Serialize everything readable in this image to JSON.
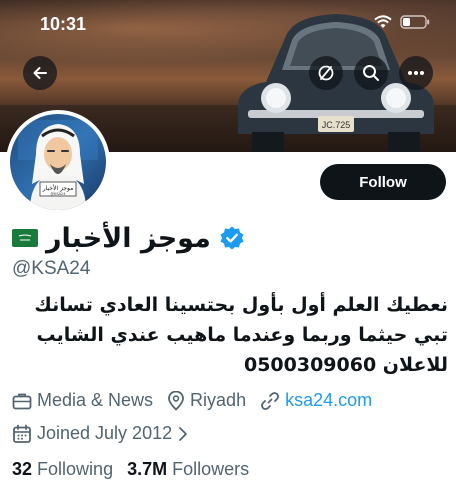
{
  "status_bar": {
    "time": "10:31"
  },
  "banner": {
    "plate_text": "JC.725"
  },
  "avatar": {
    "caption": "موجز الأخبار",
    "sub_caption": "@KSA24"
  },
  "profile": {
    "display_name": "موجز الأخبار",
    "handle": "@KSA24",
    "bio_lines": [
      "نعطيك العلم أول بأول بحتسينا العادي تسانك",
      "تبي حيثما وربما وعندما ماهيب عندي الشايب",
      "للاعلان 0500309060"
    ],
    "category": "Media & News",
    "location": "Riyadh",
    "website": "ksa24.com",
    "joined": "Joined July 2012",
    "following_count": "32",
    "following_label": "Following",
    "followers_count": "3.7M",
    "followers_label": "Followers"
  },
  "actions": {
    "follow_label": "Follow"
  },
  "colors": {
    "accent": "#1d9bf0",
    "text": "#0f1419",
    "muted": "#536471",
    "flag": "#1a7a3c"
  }
}
